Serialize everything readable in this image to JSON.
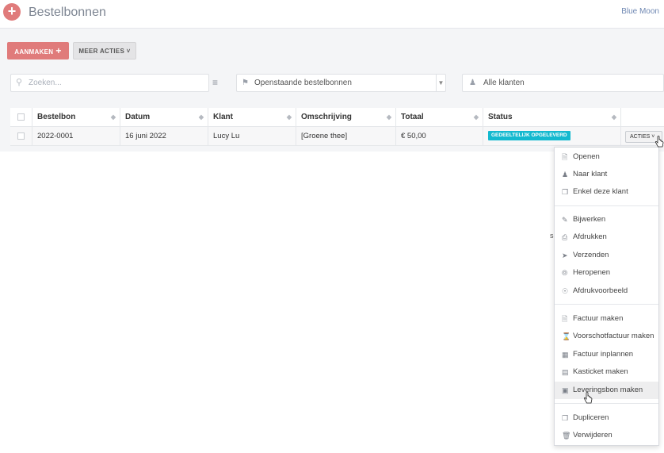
{
  "header": {
    "title": "Bestelbonnen",
    "company": "Blue Moon",
    "app_icon": "+"
  },
  "toolbar": {
    "create_label": "AANMAKEN",
    "create_icon": "+",
    "more_label": "MEER ACTIES ˅"
  },
  "filters": {
    "search_placeholder": "Zoeken...",
    "order_filter": "Openstaande bestelbonnen",
    "client_filter": "Alle klanten"
  },
  "table": {
    "columns": [
      "Bestelbon",
      "Datum",
      "Klant",
      "Omschrijving",
      "Totaal",
      "Status"
    ],
    "rows": [
      {
        "bestelbon": "2022-0001",
        "datum": "16 juni 2022",
        "klant": "Lucy Lu",
        "omschrijving": "[Groene thee]",
        "totaal": "€ 50,00",
        "status": "GEDEELTELIJK OPGELEVERD",
        "actions_label": "ACTIES ˅"
      }
    ]
  },
  "actions_menu": {
    "groups": [
      [
        {
          "label": "Openen",
          "icon": "file-icon"
        },
        {
          "label": "Naar klant",
          "icon": "user-icon"
        },
        {
          "label": "Enkel deze klant",
          "icon": "copy-icon"
        }
      ],
      [
        {
          "label": "Bijwerken",
          "icon": "edit-icon"
        },
        {
          "label": "Afdrukken",
          "icon": "printer-icon"
        },
        {
          "label": "Verzenden",
          "icon": "send-icon"
        },
        {
          "label": "Heropenen",
          "icon": "compass-icon"
        },
        {
          "label": "Afdrukvoorbeeld",
          "icon": "eye-icon"
        }
      ],
      [
        {
          "label": "Factuur maken",
          "icon": "file-icon"
        },
        {
          "label": "Voorschotfactuur maken",
          "icon": "hourglass-icon"
        },
        {
          "label": "Factuur inplannen",
          "icon": "calendar-icon"
        },
        {
          "label": "Kasticket maken",
          "icon": "receipt-icon"
        },
        {
          "label": "Leveringsbon maken",
          "icon": "box-icon",
          "hover": true
        }
      ],
      [
        {
          "label": "Dupliceren",
          "icon": "duplicate-icon"
        },
        {
          "label": "Verwijderen",
          "icon": "trash-icon"
        }
      ]
    ]
  },
  "colors": {
    "accent": "#e07b7b",
    "status_badge": "#13b9cf",
    "link": "#6f88b3"
  }
}
